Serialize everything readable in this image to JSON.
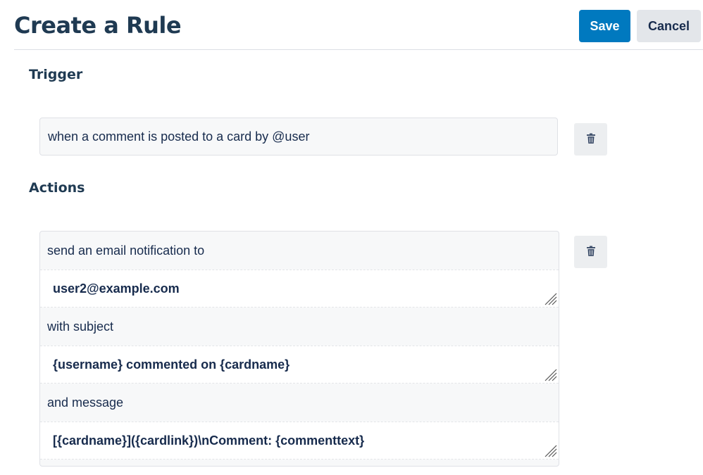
{
  "header": {
    "title": "Create a Rule",
    "save_label": "Save",
    "cancel_label": "Cancel"
  },
  "trigger": {
    "heading": "Trigger",
    "text": "when a comment is posted to a card by @user",
    "delete_icon": "trash-icon"
  },
  "actions": {
    "heading": "Actions",
    "delete_icon": "trash-icon",
    "rows": {
      "label_send": "send an email notification to",
      "to_value": "user2@example.com",
      "label_subject": "with subject",
      "subject_value": "{username} commented on {cardname}",
      "label_message": "and message",
      "message_value": "[{cardname}]({cardlink})\\nComment: {commenttext}"
    }
  },
  "colors": {
    "primary": "#0079bf",
    "title": "#1f3a52",
    "secondary_button": "#e3e6ea"
  }
}
